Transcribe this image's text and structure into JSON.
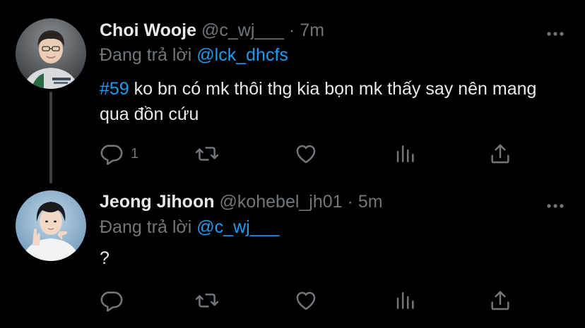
{
  "colors": {
    "background": "#000000",
    "text": "#e7e9ea",
    "secondary": "#71767b",
    "accent": "#1d9bf0",
    "thread_line": "#3d4145"
  },
  "tweets": [
    {
      "display_name": "Choi Wooje",
      "handle": "@c_wj___",
      "separator": "·",
      "time": "7m",
      "reply_prefix": "Đang trả lời",
      "reply_to": "@lck_dhcfs",
      "hashtag": "#59",
      "text": " ko bn có mk thôi thg kia bọn mk thấy say nên mang qua đồn cứu",
      "reply_count": "1",
      "avatar_icon": "avatar-photo",
      "more_icon": "more-dots-icon"
    },
    {
      "display_name": "Jeong Jihoon",
      "handle": "@kohebel_jh01",
      "separator": "·",
      "time": "5m",
      "reply_prefix": "Đang trả lời",
      "reply_to": "@c_wj___",
      "text": "?",
      "reply_count": "",
      "avatar_icon": "avatar-photo",
      "more_icon": "more-dots-icon"
    }
  ],
  "action_icons": [
    "reply-icon",
    "retweet-icon",
    "like-icon",
    "stats-icon",
    "share-icon"
  ]
}
